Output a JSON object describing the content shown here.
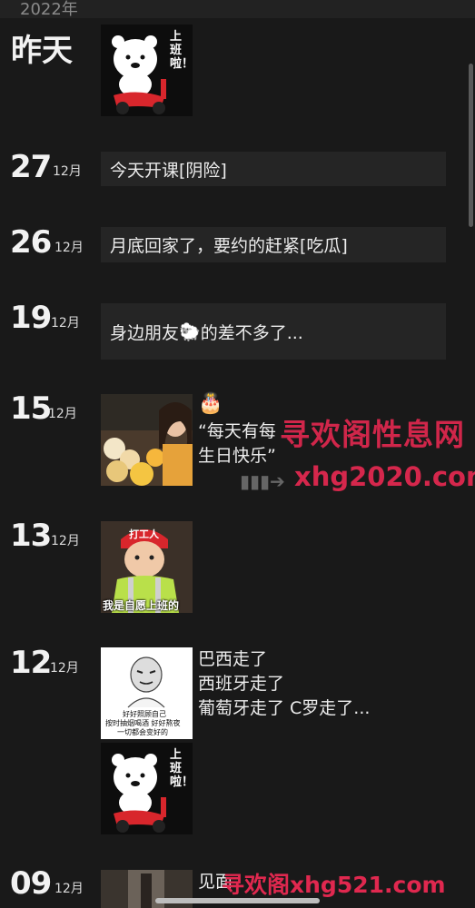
{
  "year": "2022年",
  "yesterday": {
    "label": "昨天",
    "sticker_text": "上班啦！"
  },
  "entries": [
    {
      "day": "27",
      "month": "12月",
      "text": "今天开课[阴险]"
    },
    {
      "day": "26",
      "month": "12月",
      "text": "月底回家了，要约的赶紧[吃瓜]"
    },
    {
      "day": "19",
      "month": "12月",
      "text_before": "身边朋友",
      "emoji": "🐑",
      "text_after": "的差不多了..."
    },
    {
      "day": "15",
      "month": "12月",
      "cake": "🎂",
      "text_line1": "“每天有每",
      "text_line2": "生日快乐”"
    },
    {
      "day": "13",
      "month": "12月",
      "photo_hat": "打工人",
      "photo_caption": "我是自愿上班的"
    },
    {
      "day": "12",
      "month": "12月",
      "lines": [
        "巴西走了",
        "西班牙走了",
        "葡萄牙走了 C罗走了..."
      ],
      "meme_caption_1": "好好照顾自己",
      "meme_caption_2": "按时抽烟喝酒 好好熬夜",
      "meme_caption_3": "一切都会变好的",
      "sticker_text": "上班啦！"
    },
    {
      "day": "09",
      "month": "12月",
      "text": "见面"
    }
  ],
  "watermarks": {
    "wm1": "寻欢阁性息网",
    "wm2": "xhg2020.com",
    "wm3": "寻欢阁xhg521.com"
  },
  "colors": {
    "background": "#191919",
    "card": "#252525",
    "watermark": "#e0284f"
  }
}
